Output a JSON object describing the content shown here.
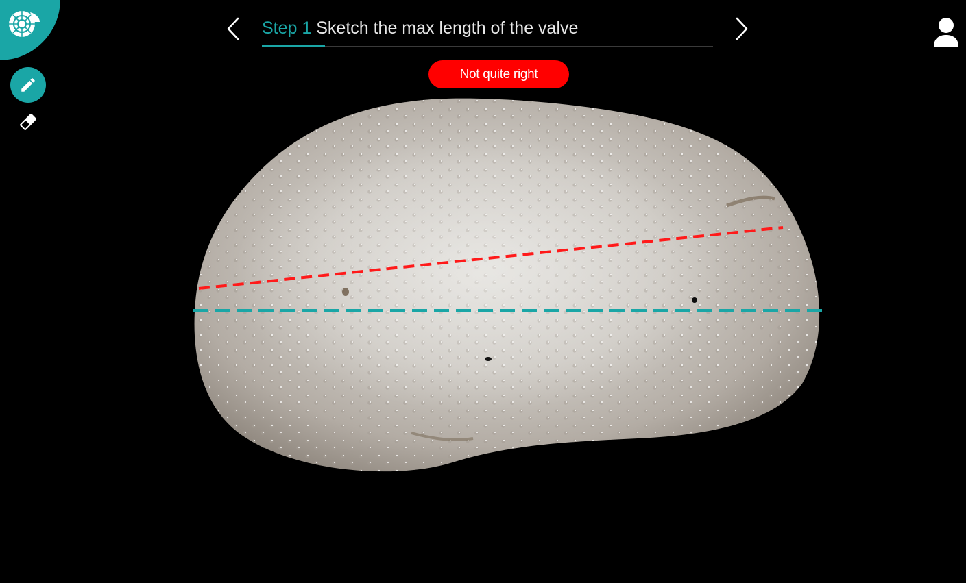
{
  "header": {
    "step_label": "Step 1",
    "instruction": "Sketch the max length of the valve",
    "progress_fraction": 0.14
  },
  "feedback": {
    "message": "Not quite right",
    "color": "#ff0000"
  },
  "theme": {
    "accent": "#1aa6a6",
    "background": "#000000",
    "user_line_color": "#ff1a1a",
    "reference_line_color": "#1aa6a6"
  },
  "icons": {
    "logo": "shell-logo-icon",
    "pencil": "pencil-icon",
    "eraser": "eraser-icon",
    "prev": "chevron-left-icon",
    "next": "chevron-right-icon",
    "user": "user-icon"
  }
}
